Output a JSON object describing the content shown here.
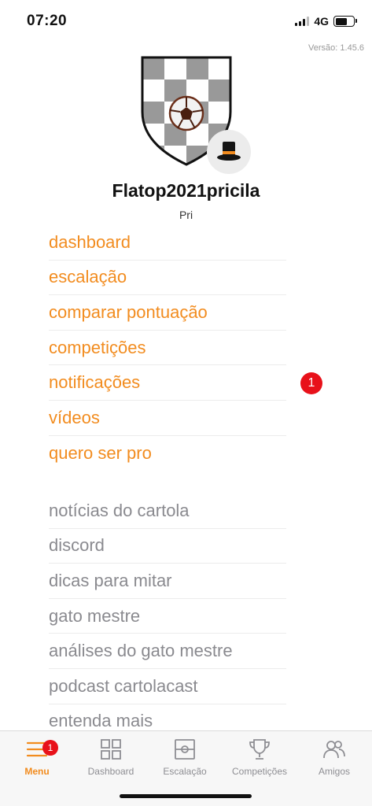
{
  "status_bar": {
    "time": "07:20",
    "network": "4G",
    "battery_icon": "battery-icon",
    "signal_icon": "signal-bars-icon"
  },
  "version": "Versão: 1.45.6",
  "profile": {
    "team_name": "Flatop2021pricila",
    "owner_name": "Pri",
    "crest_icon": "team-crest-icon",
    "avatar_icon": "top-hat-avatar-icon"
  },
  "menu_primary": [
    {
      "label": "dashboard"
    },
    {
      "label": "escalação"
    },
    {
      "label": "comparar pontuação"
    },
    {
      "label": "competições"
    },
    {
      "label": "notificações",
      "badge": "1"
    },
    {
      "label": "vídeos"
    },
    {
      "label": "quero ser pro"
    }
  ],
  "menu_secondary": [
    {
      "label": "notícias do cartola"
    },
    {
      "label": "discord"
    },
    {
      "label": "dicas para mitar"
    },
    {
      "label": "gato mestre"
    },
    {
      "label": "análises do gato mestre"
    },
    {
      "label": "podcast cartolacast"
    },
    {
      "label": "entenda mais"
    }
  ],
  "tab_bar": {
    "tabs": [
      {
        "label": "Menu",
        "icon": "hamburger-menu-icon",
        "badge": "1",
        "active": true
      },
      {
        "label": "Dashboard",
        "icon": "grid-icon"
      },
      {
        "label": "Escalação",
        "icon": "soccer-field-icon"
      },
      {
        "label": "Competições",
        "icon": "trophy-icon"
      },
      {
        "label": "Amigos",
        "icon": "friends-icon"
      }
    ]
  },
  "colors": {
    "accent": "#f28c1f",
    "badge": "#e8111a",
    "secondary_text": "#8a8a8f"
  }
}
